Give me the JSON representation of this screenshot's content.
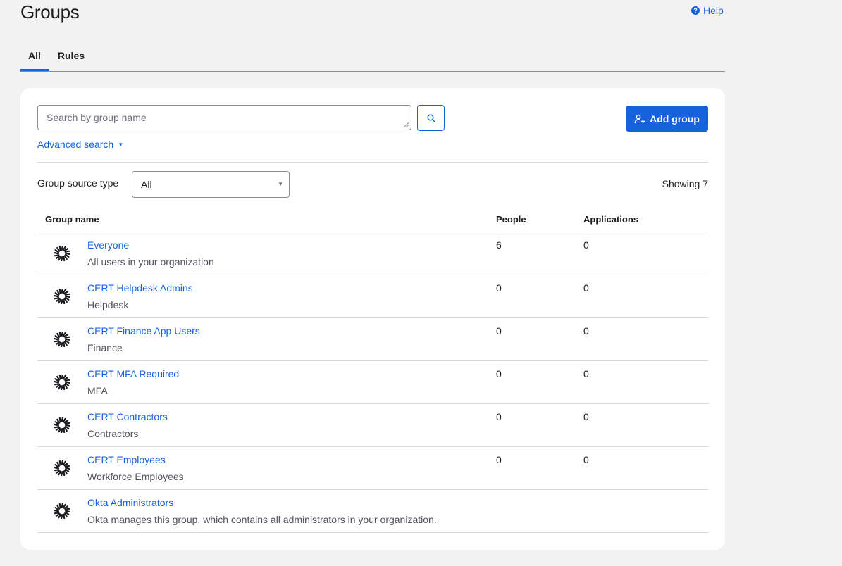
{
  "page": {
    "title": "Groups",
    "help_label": "Help"
  },
  "tabs": [
    {
      "label": "All",
      "active": true
    },
    {
      "label": "Rules",
      "active": false
    }
  ],
  "toolbar": {
    "search_placeholder": "Search by group name",
    "search_value": "",
    "add_group_label": "Add group",
    "advanced_search_label": "Advanced search"
  },
  "filter": {
    "source_type_label": "Group source type",
    "source_type_value": "All",
    "showing_text": "Showing 7"
  },
  "table": {
    "headers": {
      "name": "Group name",
      "people": "People",
      "apps": "Applications"
    },
    "rows": [
      {
        "name": "Everyone",
        "description": "All users in your organization",
        "people": "6",
        "apps": "0"
      },
      {
        "name": "CERT Helpdesk Admins",
        "description": "Helpdesk",
        "people": "0",
        "apps": "0"
      },
      {
        "name": "CERT Finance App Users",
        "description": "Finance",
        "people": "0",
        "apps": "0"
      },
      {
        "name": "CERT MFA Required",
        "description": "MFA",
        "people": "0",
        "apps": "0"
      },
      {
        "name": "CERT Contractors",
        "description": "Contractors",
        "people": "0",
        "apps": "0"
      },
      {
        "name": "CERT Employees",
        "description": "Workforce Employees",
        "people": "0",
        "apps": "0"
      },
      {
        "name": "Okta Administrators",
        "description": "Okta manages this group, which contains all administrators in your organization.",
        "people": "",
        "apps": ""
      }
    ]
  },
  "colors": {
    "accent": "#1662dd",
    "background": "#f2f2f2",
    "card": "#ffffff",
    "divider": "#d7d7dc"
  },
  "icons": {
    "help": "help-circle-icon",
    "search": "search-icon",
    "add_group": "add-group-icon",
    "group": "okta-sunburst-icon",
    "caret": "caret-down-icon"
  }
}
